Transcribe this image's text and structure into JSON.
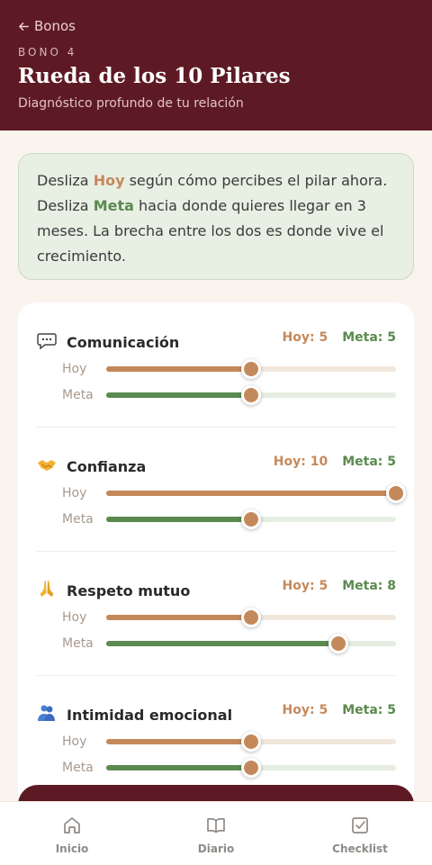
{
  "header": {
    "back_label": "Bonos",
    "eyebrow": "BONO 4",
    "title": "Rueda de los 10 Pilares",
    "subtitle": "Diagnóstico profundo de tu relación"
  },
  "intro": {
    "part1": "Desliza ",
    "hoy_word": "Hoy",
    "part2": " según cómo percibes el pilar ahora. Desliza ",
    "meta_word": "Meta",
    "part3": " hacia donde quieres llegar en 3 meses. La brecha entre los dos es donde vive el crecimiento."
  },
  "labels": {
    "hoy_row": "Hoy",
    "meta_row": "Meta"
  },
  "scale_max": 10,
  "pillars": [
    {
      "icon": "speech-bubble-icon",
      "name": "Comunicación",
      "hoy_text": "Hoy: 5",
      "meta_text": "Meta: 5",
      "hoy": 5,
      "meta": 5
    },
    {
      "icon": "handshake-icon",
      "name": "Confianza",
      "hoy_text": "Hoy: 10",
      "meta_text": "Meta: 5",
      "hoy": 10,
      "meta": 5
    },
    {
      "icon": "praying-hands-icon",
      "name": "Respeto mutuo",
      "hoy_text": "Hoy: 5",
      "meta_text": "Meta: 8",
      "hoy": 5,
      "meta": 8
    },
    {
      "icon": "people-hugging-icon",
      "name": "Intimidad emocional",
      "hoy_text": "Hoy: 5",
      "meta_text": "Meta: 5",
      "hoy": 5,
      "meta": 5
    }
  ],
  "nav": [
    {
      "icon": "home-icon",
      "label": "Inicio"
    },
    {
      "icon": "book-icon",
      "label": "Diario"
    },
    {
      "icon": "checklist-icon",
      "label": "Checklist"
    }
  ],
  "colors": {
    "brand": "#5e1a24",
    "hoy": "#c4895b",
    "meta": "#5a8a4f",
    "intro_bg": "#e8efe3",
    "page_bg": "#faf4ee"
  }
}
